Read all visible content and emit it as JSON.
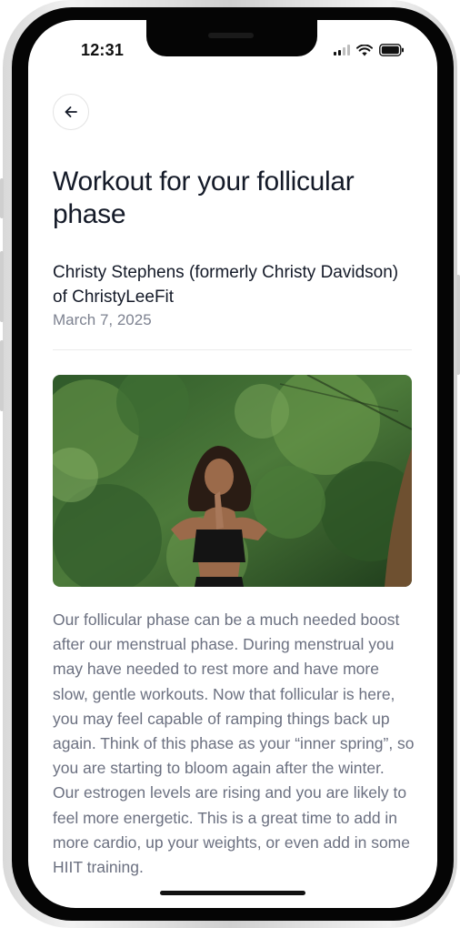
{
  "status_bar": {
    "time": "12:31",
    "icons": [
      "signal-icon",
      "wifi-icon",
      "battery-icon"
    ]
  },
  "nav": {
    "back_icon": "arrow-left-icon"
  },
  "article": {
    "title": "Workout for your follicular phase",
    "author": "Christy Stephens (formerly Christy Davidson) of ChristyLeeFit",
    "date": "March 7, 2025",
    "image_description": "Woman with curly hair in black sports top, hands in prayer pose, standing in a lush green forest",
    "body": "Our follicular phase can be a much needed boost after our menstrual phase. During menstrual you may have needed to rest more and have more slow, gentle workouts. Now that follicular is here, you may feel capable of ramping things back up again. Think of this phase as your “inner spring”, so you are starting to bloom again after the winter. Our estrogen levels are rising and you are likely to feel more energetic. This is a great time to add in more cardio, up your weights, or even add in some HIIT training."
  },
  "colors": {
    "title": "#141a28",
    "body_text": "#6b7080",
    "date": "#7d8290",
    "background": "#ffffff"
  }
}
